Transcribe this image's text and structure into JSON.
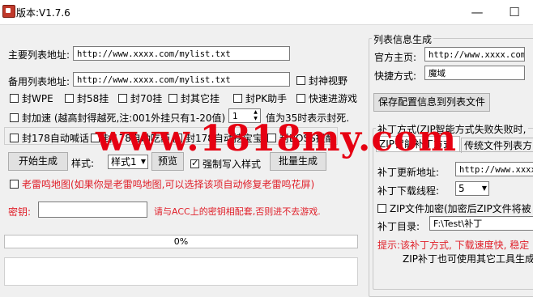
{
  "window": {
    "title": "版本:V1.7.6",
    "min_symbol": "—",
    "max_symbol": "☐"
  },
  "main": {
    "primary_list_label": "主要列表地址:",
    "primary_list_value": "http://www.xxxx.com/mylist.txt",
    "backup_list_label": "备用列表地址:",
    "backup_list_value": "http://www.xxxx.com/mylist.txt",
    "block_view_label": "封神视野",
    "row1": [
      "封WPE",
      "封58挂",
      "封70挂",
      "封其它挂",
      "封PK助手",
      "快速进游戏"
    ],
    "speed_label": "封加速 (越高封得越死,注:001外挂只有1-20值)",
    "speed_value": "1",
    "speed_note": "值为35时表示封死.",
    "row3": [
      "封178自动喊话",
      "封178自动吃药",
      "封178自动挖宝宝",
      "封BOSS提醒"
    ],
    "generate_button": "开始生成",
    "style_label": "样式:",
    "style_value": "样式1",
    "preview_button": "预览",
    "force_write_label": "强制写入样式",
    "batch_button": "批量生成",
    "leitu_label": "老雷鸣地图(如果你是老雷鸣地图,可以选择该项自动修复老雷鸣花屏)",
    "key_label": "密钥:",
    "key_value": "",
    "key_hint": "请与ACC上的密钥相配套,否则进不去游戏.",
    "progress_text": "0%",
    "progress_value": 0
  },
  "right": {
    "group_title": "列表信息生成",
    "homepage_label": "官方主页:",
    "homepage_value": "http://www.xxxx.com",
    "shortcut_label": "快捷方式:",
    "shortcut_value": "魔域",
    "save_button": "保存配置信息到列表文件",
    "patch_group_title": "补丁方式(ZIP智能方式失败失败时,",
    "tab_zip": "ZIP智能补丁方式",
    "tab_traditional": "传统文件列表方",
    "patch_url_label": "补丁更新地址:",
    "patch_url_value": "http://www.xxxx.",
    "threads_label": "补丁下载线程:",
    "threads_value": "5",
    "zip_encrypt_label": "ZIP文件加密(加密后ZIP文件将被",
    "patch_dir_label": "补丁目录:",
    "patch_dir_value": "F:\\Test\\补丁",
    "tip_line1": "提示:该补丁方式, 下载速度快, 稳定",
    "tip_line2": "ZIP补丁也可使用其它工具生成"
  },
  "watermark": "www.1818my.com",
  "colors": {
    "accent_red": "#e0202a",
    "watermark_red": "#e60012"
  }
}
